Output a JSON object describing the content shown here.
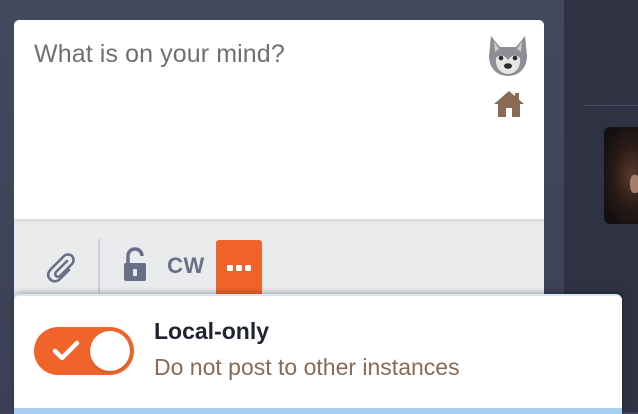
{
  "compose": {
    "placeholder": "What is on your mind?",
    "avatar_icon": "wolf-avatar-icon",
    "visibility_icon": "home-icon"
  },
  "toolbar": {
    "attach_icon": "paperclip-icon",
    "privacy_icon": "unlock-icon",
    "cw_label": "CW",
    "more_icon": "ellipsis-icon"
  },
  "dropdown": {
    "option": {
      "title": "Local-only",
      "description": "Do not post to other instances",
      "enabled": true
    }
  },
  "colors": {
    "accent": "#f0632b",
    "icon_gray": "#686f87",
    "description_brown": "#8a6a52",
    "background": "#3f4458"
  }
}
